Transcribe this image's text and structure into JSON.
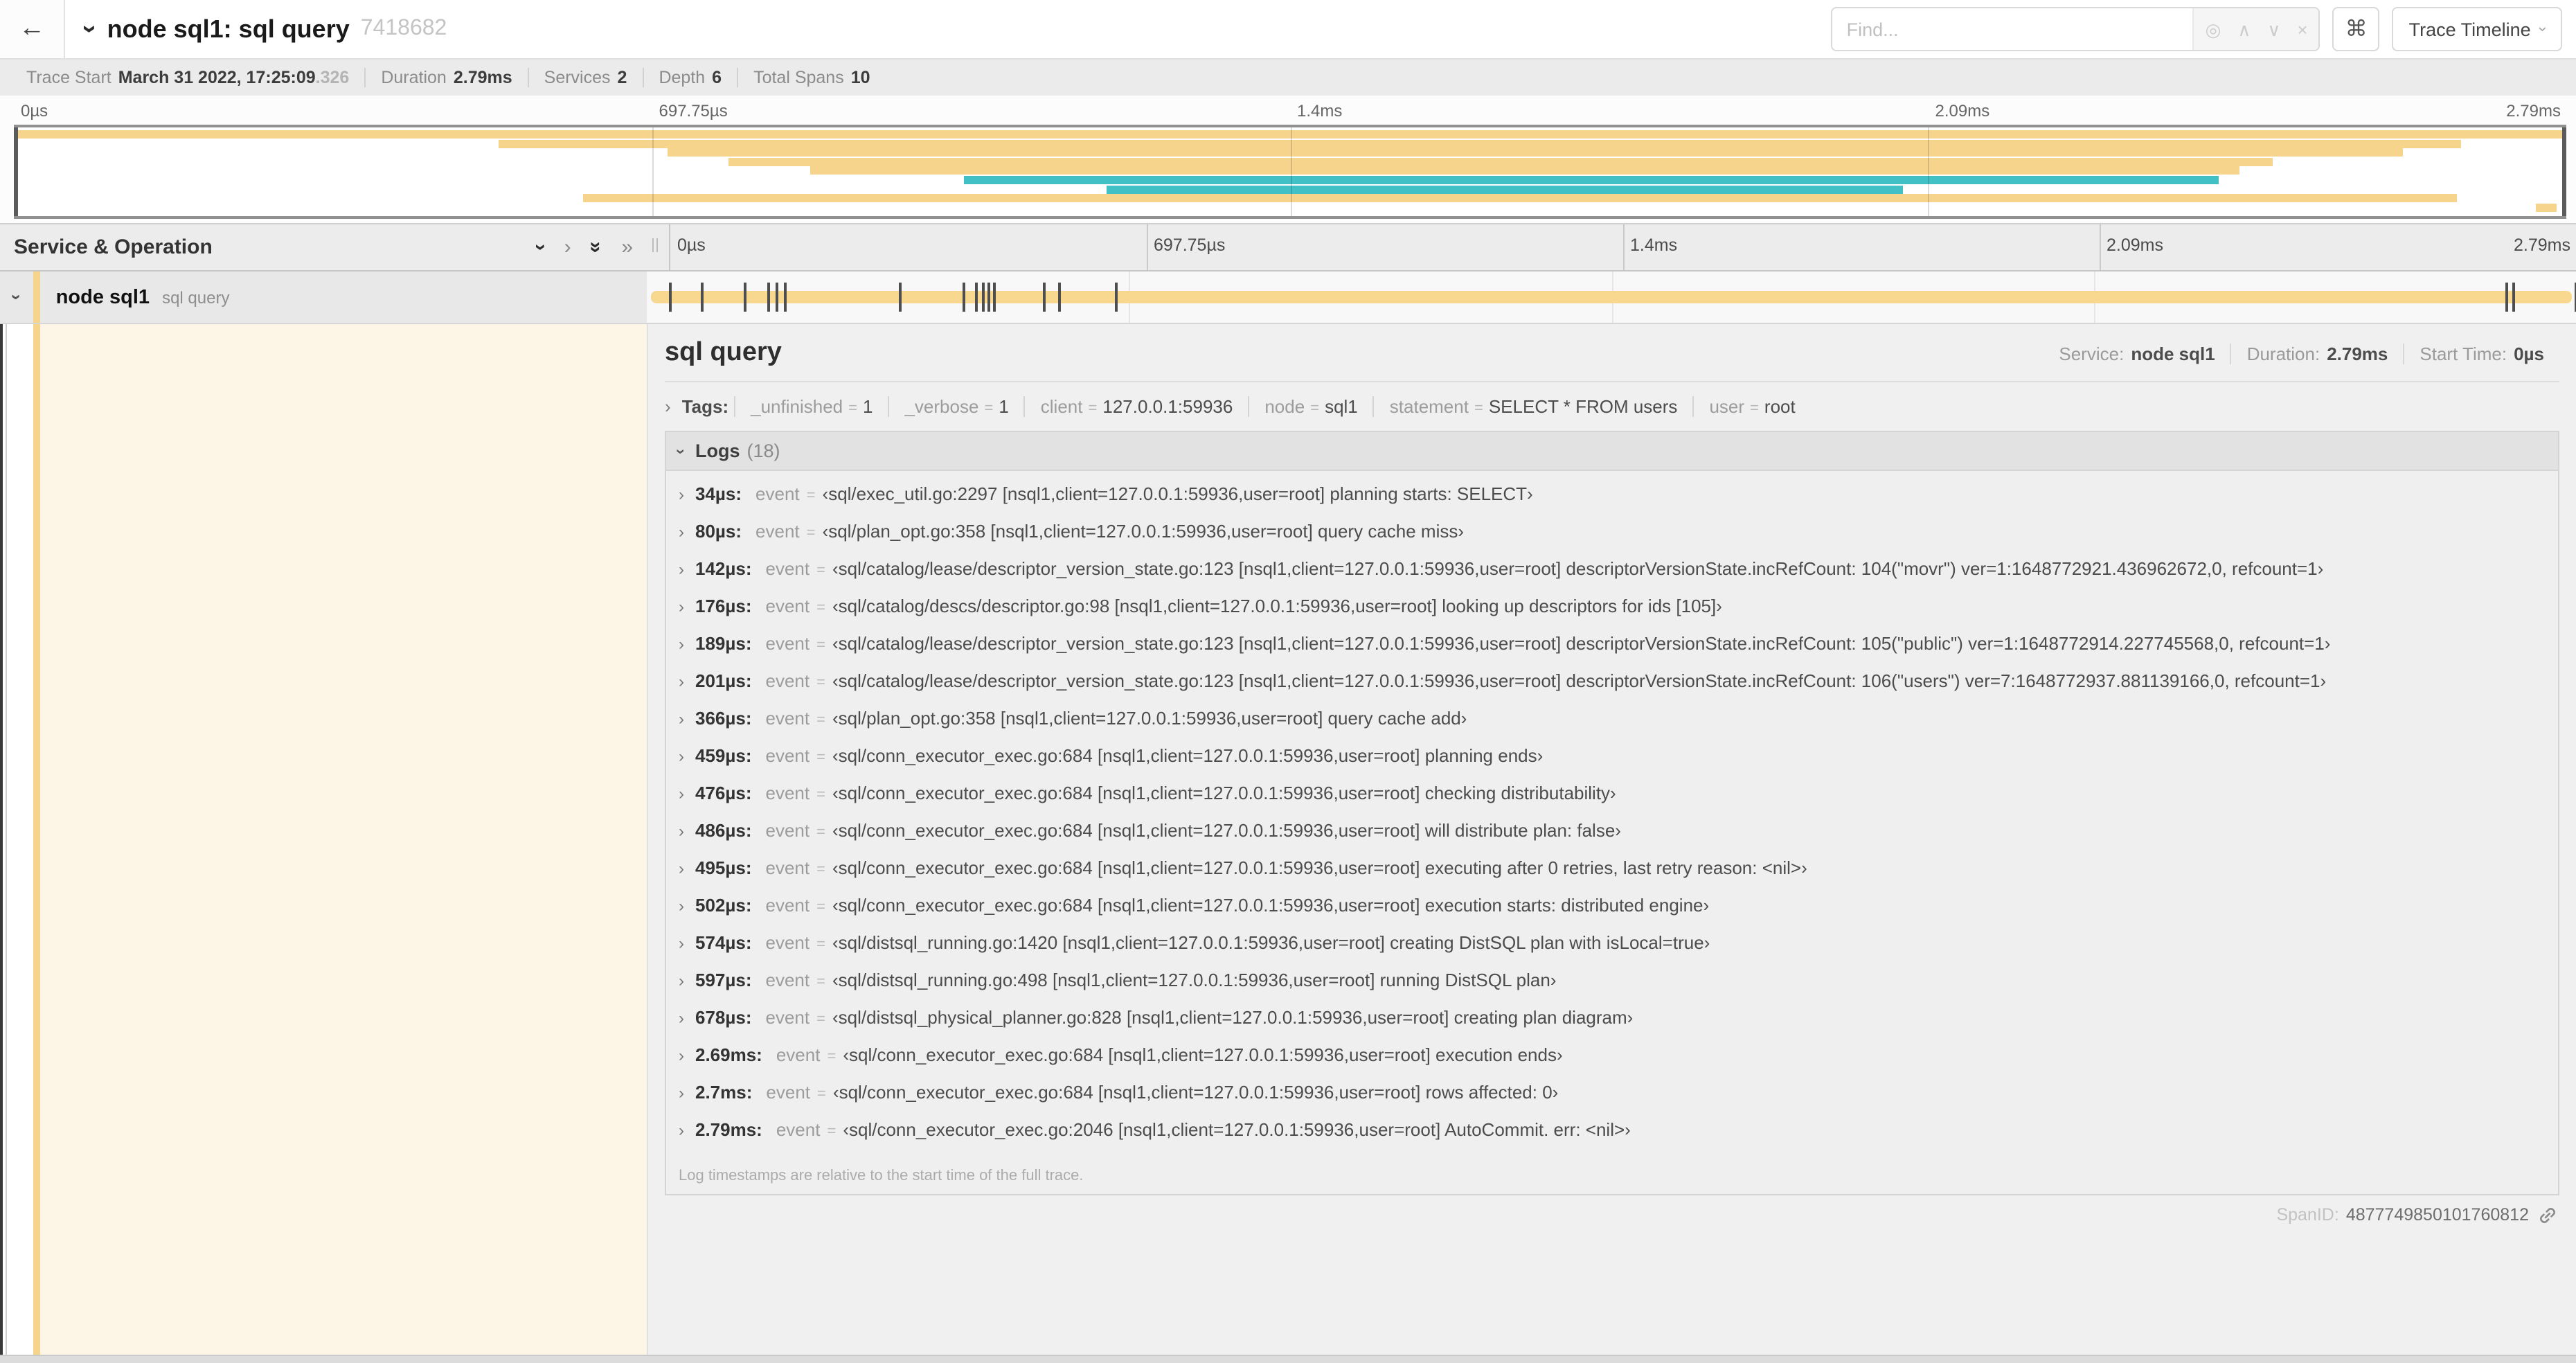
{
  "colors": {
    "span_tan": "#f7d48b",
    "span_tan_bar": "#f8d78f",
    "span_teal": "#41c1c5",
    "cream": "#fdf5e6",
    "accent_dark": "#3a3a3a"
  },
  "header": {
    "back_icon": "←",
    "title": "node sql1: sql query",
    "trace_id": "7418682",
    "find_placeholder": "Find...",
    "find_icons": [
      "◎",
      "∧",
      "∨",
      "×"
    ],
    "shortcut_key": "⌘",
    "view_selector": "Trace Timeline"
  },
  "stats": {
    "items": [
      {
        "label": "Trace Start",
        "value": "March 31 2022, 17:25:09",
        "suffix": ".326"
      },
      {
        "label": "Duration",
        "value": "2.79ms"
      },
      {
        "label": "Services",
        "value": "2"
      },
      {
        "label": "Depth",
        "value": "6"
      },
      {
        "label": "Total Spans",
        "value": "10"
      }
    ]
  },
  "timeline": {
    "duration_us": 2790,
    "ticks": [
      {
        "label": "0µs",
        "pos": 0
      },
      {
        "label": "697.75µs",
        "pos": 25
      },
      {
        "label": "1.4ms",
        "pos": 50
      },
      {
        "label": "2.09ms",
        "pos": 75
      },
      {
        "label": "2.79ms",
        "pos": 100
      }
    ],
    "minimap_rows": [
      {
        "start": 0,
        "end": 100,
        "color": "tan"
      },
      {
        "start": 19,
        "end": 95.9,
        "color": "tan"
      },
      {
        "start": 25.6,
        "end": 93.6,
        "color": "tan"
      },
      {
        "start": 28,
        "end": 88.5,
        "color": "tan"
      },
      {
        "start": 31.2,
        "end": 87.2,
        "color": "tan"
      },
      {
        "start": 37.2,
        "end": 86.4,
        "color": "teal"
      },
      {
        "start": 42.8,
        "end": 74,
        "color": "teal"
      },
      {
        "start": 22.3,
        "end": 95.7,
        "color": "tan"
      },
      {
        "start": 98.8,
        "end": 99.6,
        "color": "tan"
      }
    ]
  },
  "span_table": {
    "header": "Service & Operation",
    "row": {
      "service": "node sql1",
      "operation": "sql query"
    }
  },
  "detail": {
    "title": "sql query",
    "meta": [
      {
        "label": "Service:",
        "value": "node sql1"
      },
      {
        "label": "Duration:",
        "value": "2.79ms"
      },
      {
        "label": "Start Time:",
        "value": "0µs"
      }
    ],
    "tags_label": "Tags:",
    "tags": [
      {
        "key": "_unfinished",
        "value": "1"
      },
      {
        "key": "_verbose",
        "value": "1"
      },
      {
        "key": "client",
        "value": "127.0.0.1:59936"
      },
      {
        "key": "node",
        "value": "sql1"
      },
      {
        "key": "statement",
        "value": "SELECT * FROM users"
      },
      {
        "key": "user",
        "value": "root"
      }
    ],
    "logs_label": "Logs",
    "logs_count": "(18)",
    "logs": [
      {
        "time": "34µs:",
        "t_us": 34,
        "key": "event",
        "value": "‹sql/exec_util.go:2297 [nsql1,client=127.0.0.1:59936,user=root] planning starts: SELECT›"
      },
      {
        "time": "80µs:",
        "t_us": 80,
        "key": "event",
        "value": "‹sql/plan_opt.go:358 [nsql1,client=127.0.0.1:59936,user=root] query cache miss›"
      },
      {
        "time": "142µs:",
        "t_us": 142,
        "key": "event",
        "value": "‹sql/catalog/lease/descriptor_version_state.go:123 [nsql1,client=127.0.0.1:59936,user=root] descriptorVersionState.incRefCount: 104(\"movr\") ver=1:1648772921.436962672,0, refcount=1›"
      },
      {
        "time": "176µs:",
        "t_us": 176,
        "key": "event",
        "value": "‹sql/catalog/descs/descriptor.go:98 [nsql1,client=127.0.0.1:59936,user=root] looking up descriptors for ids [105]›"
      },
      {
        "time": "189µs:",
        "t_us": 189,
        "key": "event",
        "value": "‹sql/catalog/lease/descriptor_version_state.go:123 [nsql1,client=127.0.0.1:59936,user=root] descriptorVersionState.incRefCount: 105(\"public\") ver=1:1648772914.227745568,0, refcount=1›"
      },
      {
        "time": "201µs:",
        "t_us": 201,
        "key": "event",
        "value": "‹sql/catalog/lease/descriptor_version_state.go:123 [nsql1,client=127.0.0.1:59936,user=root] descriptorVersionState.incRefCount: 106(\"users\") ver=7:1648772937.881139166,0, refcount=1›"
      },
      {
        "time": "366µs:",
        "t_us": 366,
        "key": "event",
        "value": "‹sql/plan_opt.go:358 [nsql1,client=127.0.0.1:59936,user=root] query cache add›"
      },
      {
        "time": "459µs:",
        "t_us": 459,
        "key": "event",
        "value": "‹sql/conn_executor_exec.go:684 [nsql1,client=127.0.0.1:59936,user=root] planning ends›"
      },
      {
        "time": "476µs:",
        "t_us": 476,
        "key": "event",
        "value": "‹sql/conn_executor_exec.go:684 [nsql1,client=127.0.0.1:59936,user=root] checking distributability›"
      },
      {
        "time": "486µs:",
        "t_us": 486,
        "key": "event",
        "value": "‹sql/conn_executor_exec.go:684 [nsql1,client=127.0.0.1:59936,user=root] will distribute plan: false›"
      },
      {
        "time": "495µs:",
        "t_us": 495,
        "key": "event",
        "value": "‹sql/conn_executor_exec.go:684 [nsql1,client=127.0.0.1:59936,user=root] executing after 0 retries, last retry reason: <nil>›"
      },
      {
        "time": "502µs:",
        "t_us": 502,
        "key": "event",
        "value": "‹sql/conn_executor_exec.go:684 [nsql1,client=127.0.0.1:59936,user=root] execution starts: distributed engine›"
      },
      {
        "time": "574µs:",
        "t_us": 574,
        "key": "event",
        "value": "‹sql/distsql_running.go:1420 [nsql1,client=127.0.0.1:59936,user=root] creating DistSQL plan with isLocal=true›"
      },
      {
        "time": "597µs:",
        "t_us": 597,
        "key": "event",
        "value": "‹sql/distsql_running.go:498 [nsql1,client=127.0.0.1:59936,user=root] running DistSQL plan›"
      },
      {
        "time": "678µs:",
        "t_us": 678,
        "key": "event",
        "value": "‹sql/distsql_physical_planner.go:828 [nsql1,client=127.0.0.1:59936,user=root] creating plan diagram›"
      },
      {
        "time": "2.69ms:",
        "t_us": 2690,
        "key": "event",
        "value": "‹sql/conn_executor_exec.go:684 [nsql1,client=127.0.0.1:59936,user=root] execution ends›"
      },
      {
        "time": "2.7ms:",
        "t_us": 2700,
        "key": "event",
        "value": "‹sql/conn_executor_exec.go:684 [nsql1,client=127.0.0.1:59936,user=root] rows affected: 0›"
      },
      {
        "time": "2.79ms:",
        "t_us": 2790,
        "key": "event",
        "value": "‹sql/conn_executor_exec.go:2046 [nsql1,client=127.0.0.1:59936,user=root] AutoCommit. err: <nil>›"
      }
    ],
    "note": "Log timestamps are relative to the start time of the full trace.",
    "span_id_label": "SpanID:",
    "span_id": "4877749850101760812"
  }
}
